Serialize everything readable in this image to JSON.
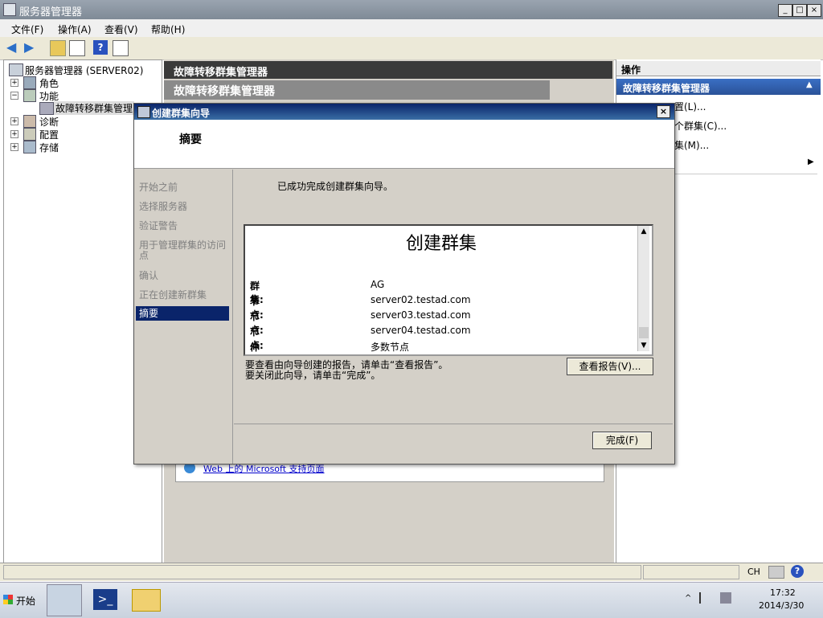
{
  "window": {
    "title": "服务器管理器",
    "buttons": [
      "_",
      "□",
      "×"
    ]
  },
  "menu": {
    "file": "文件(F)",
    "action": "操作(A)",
    "view": "查看(V)",
    "help": "帮助(H)"
  },
  "tree": {
    "root": "服务器管理器 (SERVER02)",
    "roles": "角色",
    "features": "功能",
    "failover": "故障转移群集管理",
    "diagnostics": "诊断",
    "configuration": "配置",
    "storage": "存储"
  },
  "center": {
    "header1": "故障转移群集管理器",
    "header2": "故障转移群集管理器",
    "link": "Web 上的 Microsoft 支持页面"
  },
  "actions": {
    "header": "操作",
    "subheader": "故障转移群集管理器",
    "item1": "置(L)...",
    "item2": "个群集(C)...",
    "item3": "集(M)..."
  },
  "dialog": {
    "title": "创建群集向导",
    "heading": "摘要",
    "close": "×",
    "steps": [
      "开始之前",
      "选择服务器",
      "验证警告",
      "用于管理群集的访问点",
      "确认",
      "正在创建新群集",
      "摘要"
    ],
    "success_message": "已成功完成创建群集向导。",
    "report": {
      "title": "创建群集",
      "rows": [
        {
          "label": "群集:",
          "value": "AG"
        },
        {
          "label": "节点:",
          "value": "server02.testad.com"
        },
        {
          "label": "节点:",
          "value": "server03.testad.com"
        },
        {
          "label": "节点:",
          "value": "server04.testad.com"
        },
        {
          "label": "仲裁:",
          "value": "多数节点"
        }
      ]
    },
    "hint_line1": "要查看由向导创建的报告，请单击“查看报告”。",
    "hint_line2": "要关闭此向导，请单击“完成”。",
    "view_report_button": "查看报告(V)...",
    "finish_button": "完成(F)"
  },
  "statusbar": {
    "lang": "CH"
  },
  "taskbar": {
    "start": "开始",
    "time": "17:32",
    "date": "2014/3/30"
  },
  "colors": {
    "dialog_title": "#0a246a",
    "selected_step": "#0a246a",
    "action_subheader": "#2a5298"
  }
}
